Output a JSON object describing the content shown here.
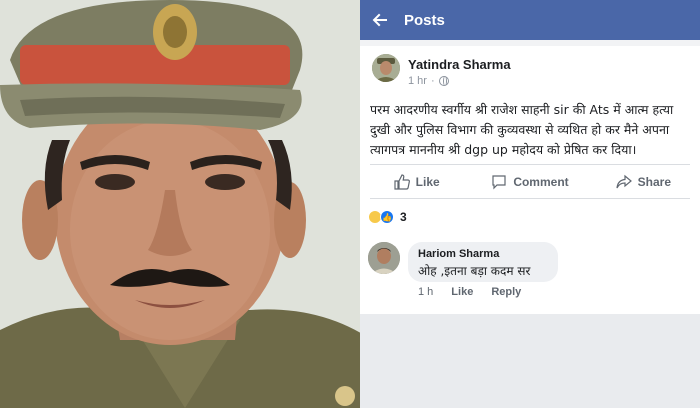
{
  "topbar": {
    "title": "Posts"
  },
  "post": {
    "author": "Yatindra Sharma",
    "time": "1 hr",
    "lines": [
      "परम आदरणीय स्वर्गीय श्री राजेश साहनी sir की Ats में आत्म हत्या",
      "दुखी और पुलिस विभाग की कुव्यवस्था से व्यथित हो कर मैने अपना",
      "त्यागपत्र माननीय श्री dgp up महोदय को प्रेषित कर दिया।"
    ]
  },
  "actions": {
    "like": "Like",
    "comment": "Comment",
    "share": "Share"
  },
  "reactions": {
    "count": "3"
  },
  "comment": {
    "name": "Hariom Sharma",
    "text": "ओह ,इतना बड़ा कदम सर",
    "time": "1 h",
    "like": "Like",
    "reply": "Reply"
  },
  "colors": {
    "facebook_blue": "#4a67a8",
    "like_blue": "#1877f2",
    "sad_yellow": "#f7c94b"
  },
  "icons": [
    "back-arrow-icon",
    "globe-icon",
    "like-icon",
    "comment-icon",
    "share-icon"
  ]
}
